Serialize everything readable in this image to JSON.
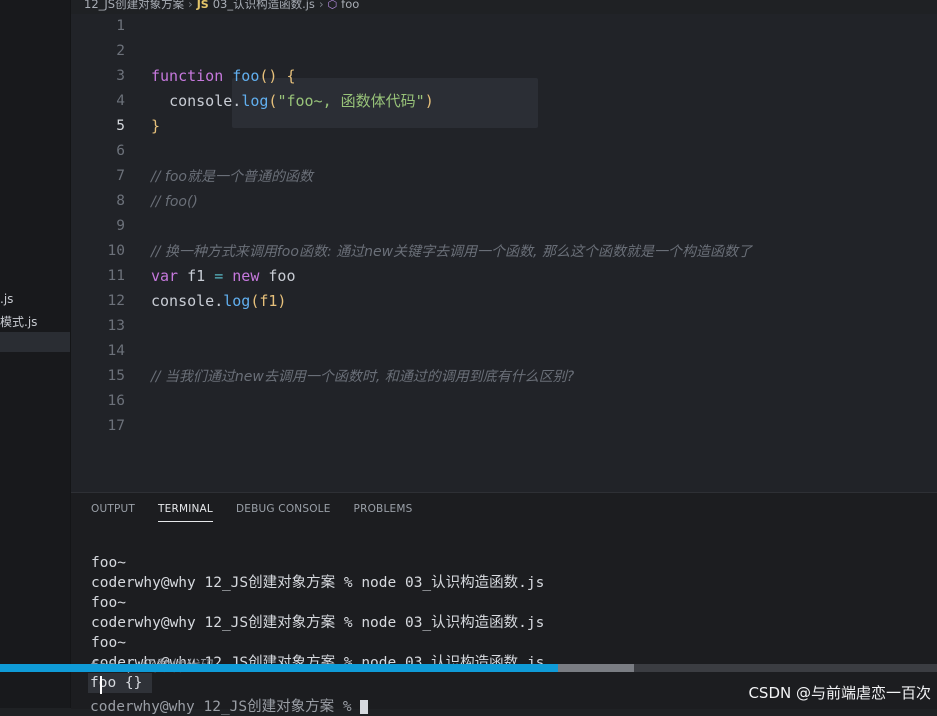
{
  "breadcrumb": {
    "folder": "12_JS创建对象方案",
    "file": "03_认识构造函数.js",
    "symbol": "foo",
    "file_icon": "JS"
  },
  "sidebar": {
    "files": [
      ".js",
      "模式.js"
    ]
  },
  "editor": {
    "line_numbers": [
      "1",
      "2",
      "3",
      "4",
      "5",
      "6",
      "7",
      "8",
      "9",
      "10",
      "11",
      "12",
      "13",
      "14",
      "15",
      "16",
      "17"
    ],
    "current_line": "5",
    "lines": {
      "l3": {
        "kw": "function",
        "name": "foo",
        "rest": "() {"
      },
      "l4": {
        "obj": "console",
        "dot": ".",
        "method": "log",
        "open": "(",
        "str": "\"foo~, 函数体代码\"",
        "close": ")"
      },
      "l5": "}",
      "l7": "// foo就是一个普通的函数",
      "l8": "// foo()",
      "l10": "// 换一种方式来调用foo函数: 通过new关键字去调用一个函数, 那么这个函数就是一个构造函数了",
      "l11": {
        "kw": "var",
        "name": "f1",
        "op": "=",
        "kw2": "new",
        "cls": "foo"
      },
      "l12": {
        "obj": "console",
        "method": "log",
        "arg": "(f1)"
      },
      "l15": "// 当我们通过new去调用一个函数时, 和通过的调用到底有什么区别?"
    }
  },
  "panel": {
    "tabs": [
      "OUTPUT",
      "TERMINAL",
      "DEBUG CONSOLE",
      "PROBLEMS"
    ],
    "active_tab": "TERMINAL",
    "terminal_lines": [
      "foo~",
      "coderwhy@why 12_JS创建对象方案 % node 03_认识构造函数.js",
      "foo~",
      "coderwhy@why 12_JS创建对象方案 % node 03_认识构造函数.js",
      "foo~",
      "coderwhy@why 12_JS创建对象方案 % node 03_认识构造函数.js"
    ],
    "overlay_line": "foo~, 函数体代码",
    "foo_object": "foo {}",
    "prompt_line": "coderwhy@why 12_JS创建对象方案 % "
  },
  "progress": {
    "fill_fraction": 0.595,
    "buffered_fraction": 0.677
  },
  "watermark": "CSDN @与前端虐恋一百次",
  "colors": {
    "accent": "#0f9bd7",
    "keyword": "#c678dd",
    "function": "#61afef",
    "string": "#98c379"
  }
}
